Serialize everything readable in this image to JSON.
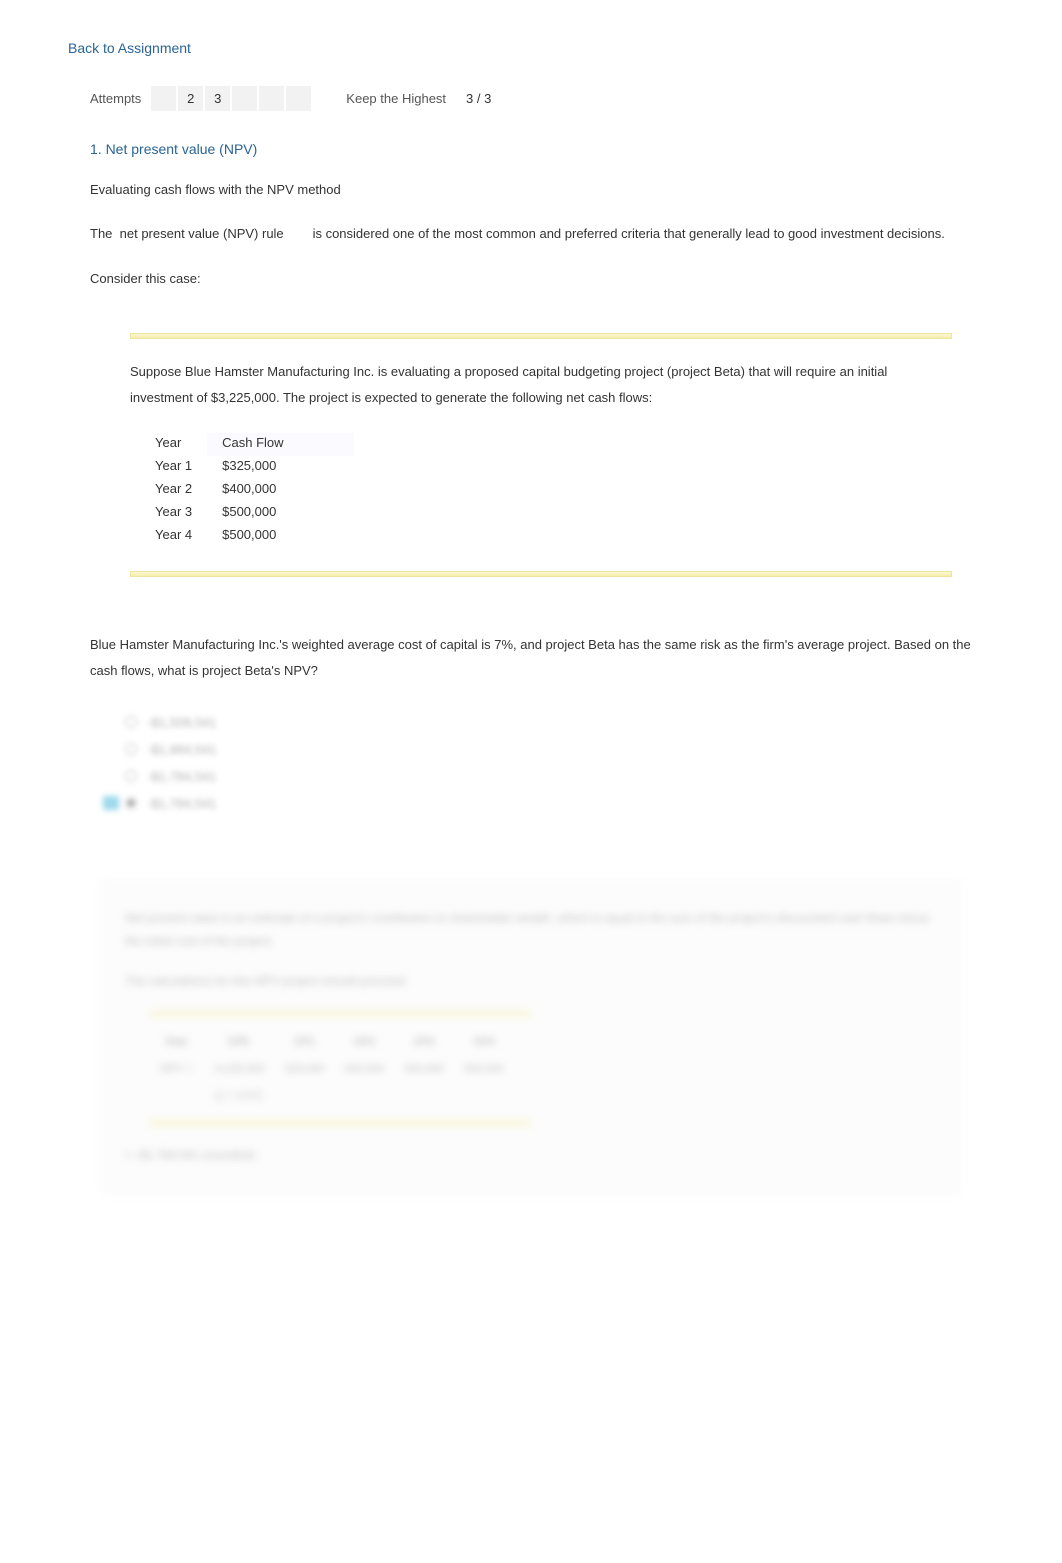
{
  "nav": {
    "back_label": "Back to Assignment"
  },
  "attempts": {
    "label": "Attempts",
    "slots": [
      "",
      "2",
      "3",
      "",
      "",
      ""
    ],
    "keep_label": "Keep the Highest",
    "score": "3 / 3"
  },
  "question": {
    "number_title": "1. Net present value (NPV)",
    "heading": "Evaluating cash flows with the NPV method",
    "intro_pre": "The",
    "rule_term": "net present value (NPV) rule",
    "intro_post": "is considered one of the most common and preferred criteria that generally lead to good investment decisions.",
    "consider": "Consider this case:"
  },
  "case": {
    "text": "Suppose Blue Hamster Manufacturing Inc. is evaluating a proposed capital budgeting project (project Beta) that will require an initial investment of $3,225,000. The project is expected to generate the following net cash flows:",
    "table": {
      "headers": [
        "Year",
        "Cash Flow"
      ],
      "rows": [
        [
          "Year 1",
          "$325,000"
        ],
        [
          "Year 2",
          "$400,000"
        ],
        [
          "Year 3",
          "$500,000"
        ],
        [
          "Year 4",
          "$500,000"
        ]
      ]
    }
  },
  "prompt": "Blue Hamster Manufacturing Inc.'s weighted average cost of capital is 7%, and project Beta has the same risk as the firm's average project. Based on the cash flows, what is project Beta's NPV?",
  "options": [
    {
      "label": "-$1,509,541",
      "selected": false
    },
    {
      "label": "-$1,984,541",
      "selected": false
    },
    {
      "label": "-$1,784,541",
      "selected": false
    },
    {
      "label": "-$1,784,541",
      "selected": true
    }
  ],
  "explain": {
    "para1": "Net present value is an estimate of a project's contribution to shareholder wealth, which is equal to the sum of the project's discounted cash flows minus the initial cost of the project.",
    "para2": "The calculations for this NPV project should proceed:",
    "wacc_table": {
      "hdr": [
        "Year",
        "CF0",
        "CF1",
        "CF2",
        "CF3",
        "CF4"
      ],
      "row_label": "NPV =",
      "row": [
        "-3,225,000",
        "(1 + 0.07)",
        "325,000",
        "400,000",
        "500,000",
        "500,000"
      ]
    },
    "calc": "= -$1,784,541 (rounded)"
  }
}
